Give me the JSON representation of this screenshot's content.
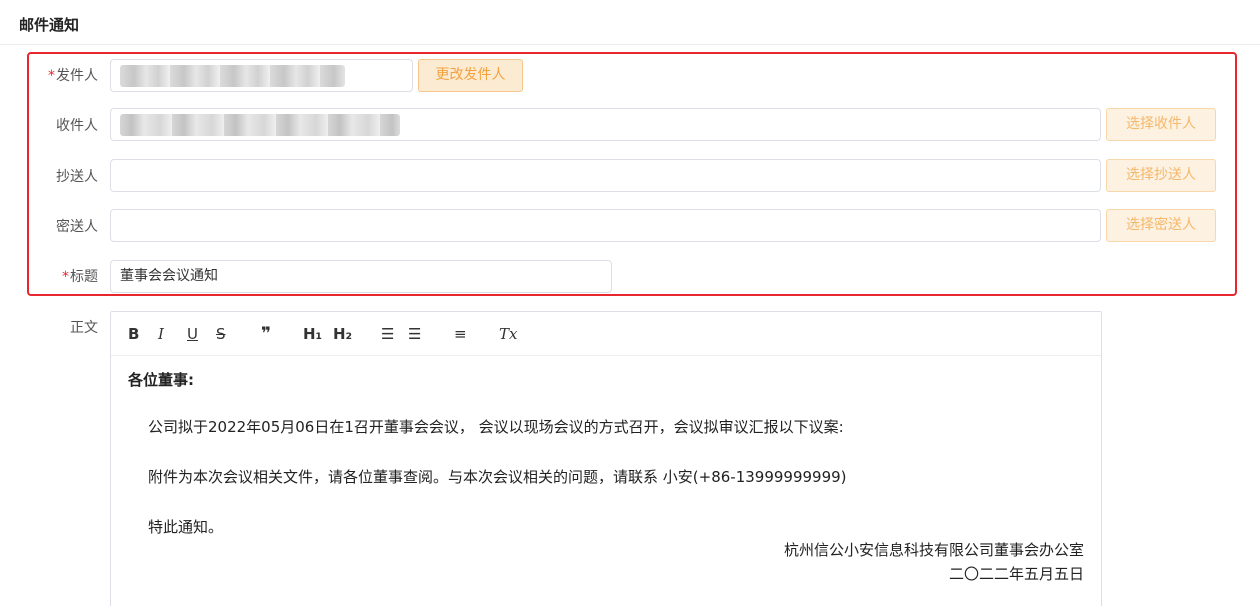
{
  "header": {
    "title": "邮件通知"
  },
  "form": {
    "sender": {
      "required_mark": "*",
      "label": "发件人",
      "change_button": "更改发件人"
    },
    "recipient": {
      "label": "收件人",
      "select_button": "选择收件人"
    },
    "cc": {
      "label": "抄送人",
      "select_button": "选择抄送人",
      "value": ""
    },
    "bcc": {
      "label": "密送人",
      "select_button": "选择密送人",
      "value": ""
    },
    "subject": {
      "required_mark": "*",
      "label": "标题",
      "value": "董事会会议通知"
    },
    "body_label": "正文"
  },
  "toolbar": {
    "bold": "B",
    "italic": "I",
    "underline": "U",
    "strike": "S",
    "quote": "❞",
    "h1": "H₁",
    "h2": "H₂",
    "ordered_list": "☰",
    "bullet_list": "☰",
    "align": "≡",
    "clear_format": "Tx"
  },
  "body": {
    "greeting": "各位董事:",
    "para1": "公司拟于2022年05月06日在1召开董事会会议， 会议以现场会议的方式召开，会议拟审议汇报以下议案:",
    "para2": "附件为本次会议相关文件，请各位董事查阅。与本次会议相关的问题，请联系 小安(+86-13999999999)",
    "para3": "特此通知。",
    "signature_org": "杭州信公小安信息科技有限公司董事会办公室",
    "signature_date": "二〇二二年五月五日"
  },
  "colors": {
    "accent_border": "#e8262e",
    "button_bg": "#fcebd3",
    "button_text": "#f2a23e"
  }
}
